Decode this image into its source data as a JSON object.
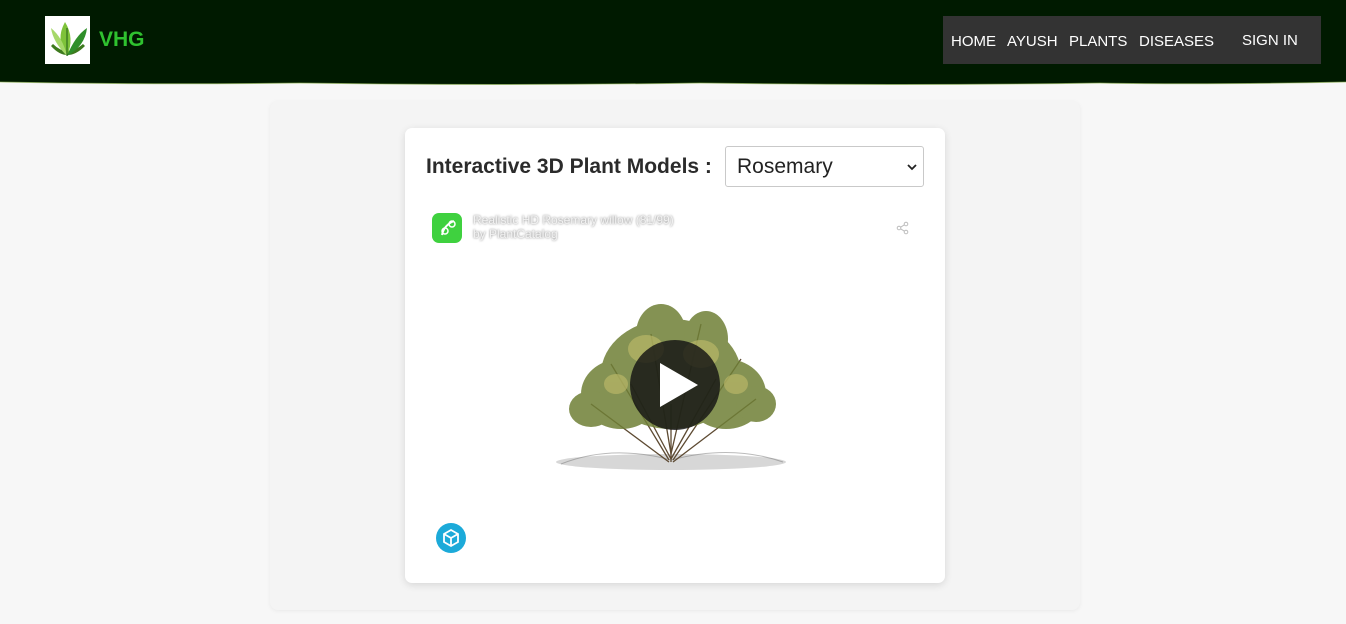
{
  "header": {
    "brand": "VHG",
    "logo_icon": "herb-leaf-logo-icon",
    "nav": {
      "home": "HOME",
      "ayush": "AYUSH",
      "plants": "PLANTS",
      "diseases": "DISEASES",
      "sign_in": "SIGN IN"
    }
  },
  "main": {
    "heading": "Interactive 3D Plant Models :",
    "select": {
      "value": "Rosemary"
    },
    "viewer": {
      "model_title": "Realistic HD Rosemary willow (81/99)",
      "model_author": "by PlantCatalog",
      "icons": [
        "model-badge-icon",
        "share-icon",
        "play-icon",
        "sketchfab-logo-icon"
      ]
    }
  },
  "colors": {
    "header_bg": "#001a00",
    "brand": "#2fc22f",
    "nav_bg": "#333333",
    "page_bg": "#f7f7f7",
    "sketchfab": "#1caad9"
  }
}
